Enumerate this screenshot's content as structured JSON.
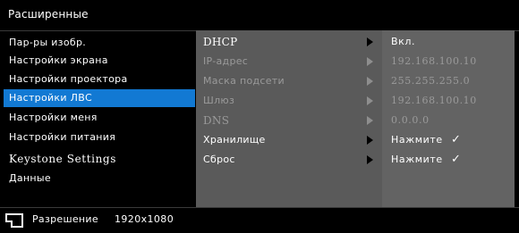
{
  "window": {
    "title": "Расширенные"
  },
  "menu": {
    "items": [
      {
        "label": "Пар-ры изобр."
      },
      {
        "label": "Настройки экрана"
      },
      {
        "label": "Настройки проектора"
      },
      {
        "label": "Настройки ЛВС",
        "selected": true
      },
      {
        "label": "Настройки меня"
      },
      {
        "label": "Настройки питания"
      },
      {
        "label": "Keystone Settings"
      },
      {
        "label": "Данные"
      }
    ]
  },
  "panel": {
    "rows": [
      {
        "label": "DHCP",
        "value": "Вкл.",
        "enabled": true
      },
      {
        "label": "IP-адрес",
        "value": "192.168.100.10",
        "enabled": false
      },
      {
        "label": "Маска подсети",
        "value": "255.255.255.0",
        "enabled": false
      },
      {
        "label": "Шлюз",
        "value": "192.168.100.10",
        "enabled": false
      },
      {
        "label": "DNS",
        "value": "0.0.0.0",
        "enabled": false
      },
      {
        "label": "Хранилище",
        "value": "Нажмите",
        "check": "✓",
        "enabled": true
      },
      {
        "label": "Сброс",
        "value": "Нажмите",
        "check": "✓",
        "enabled": true
      }
    ]
  },
  "status": {
    "resolution_label": "Разрешение",
    "resolution_value": "1920x1080",
    "icon": "resolution-icon"
  },
  "colors": {
    "selected": "#1279d3",
    "panel": "#5a5a5a",
    "value_column": "#636363",
    "disabled_text": "#9a9a9a"
  }
}
